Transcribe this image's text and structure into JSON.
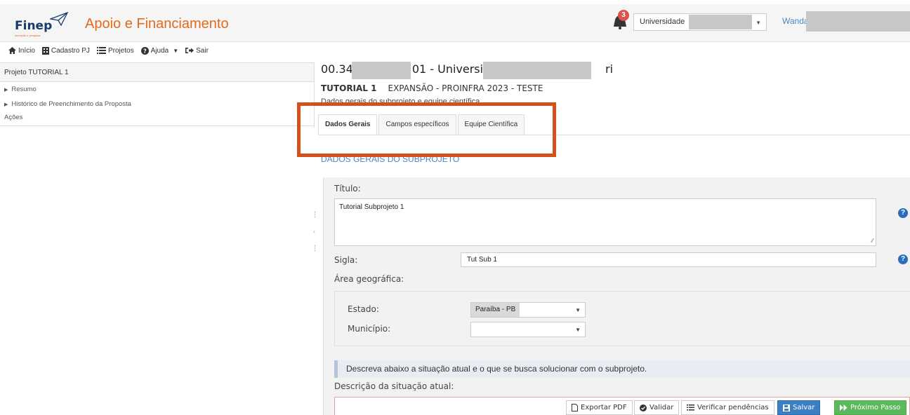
{
  "header": {
    "logo_text": "Finep",
    "logo_tagline": "inovação e pesquisa",
    "app_title": "Apoio e Financiamento",
    "notifications_count": "3",
    "organization": "Universidade",
    "user": "Wanda"
  },
  "nav": {
    "items": [
      {
        "label": "Início",
        "icon": "home-icon"
      },
      {
        "label": "Cadastro PJ",
        "icon": "building-icon"
      },
      {
        "label": "Projetos",
        "icon": "list-icon"
      },
      {
        "label": "Ajuda",
        "icon": "question-icon"
      },
      {
        "label": "Sair",
        "icon": "sign-out-icon"
      }
    ]
  },
  "sidebar": {
    "title": "Projeto TUTORIAL 1",
    "items": [
      "Resumo",
      "Histórico de Preenchimento da Proposta"
    ],
    "actions_label": "Ações"
  },
  "project": {
    "id_prefix": "00.34",
    "id_suffix": "01 - Universida",
    "id_tail": "ri",
    "code": "TUTORIAL 1",
    "program": "EXPANSÃO - PROINFRA 2023 - TESTE",
    "obscured_line": "Dados gerais do subprojeto e equipe científica"
  },
  "tabs": [
    "Dados Gerais",
    "Campos específicos",
    "Equipe Científica"
  ],
  "section_title": "DADOS GERAIS DO SUBPROJETO",
  "form": {
    "titulo_label": "Título:",
    "titulo_value": "Tutorial Subprojeto 1",
    "sigla_label": "Sigla:",
    "sigla_value": "Tut Sub 1",
    "area_label": "Área geográfica:",
    "estado_label": "Estado:",
    "estado_value": "Paraíba - PB",
    "municipio_label": "Município:",
    "municipio_value": "",
    "info_text": "Descreva abaixo a situação atual e o que se busca solucionar com o subprojeto.",
    "descricao_label": "Descrição da situação atual:"
  },
  "actions": {
    "export_pdf": "Exportar PDF",
    "validar": "Validar",
    "verificar": "Verificar pendências",
    "salvar": "Salvar",
    "proximo": "Próximo Passo"
  },
  "colors": {
    "brand_orange": "#e16b1a",
    "highlight": "#d5501b",
    "primary": "#3a7fc3",
    "success": "#5cb85c"
  }
}
